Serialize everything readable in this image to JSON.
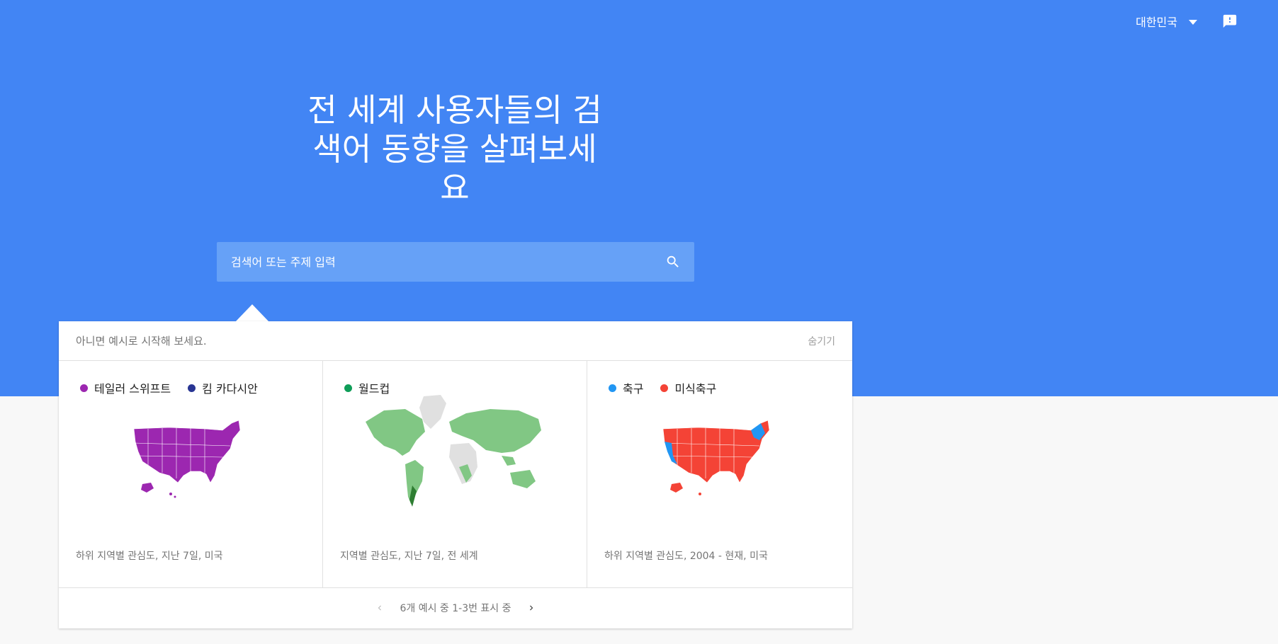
{
  "header": {
    "region": "대한민국",
    "headline": "전 세계 사용자들의 검색어 동향을 살펴보세요"
  },
  "search": {
    "placeholder": "검색어 또는 주제 입력"
  },
  "examples_panel": {
    "intro": "아니면 예시로 시작해 보세요.",
    "hide_label": "숨기기",
    "items": [
      {
        "terms": [
          {
            "label": "테일러 스위프트",
            "color": "#9c27b0"
          },
          {
            "label": "킴 카다시안",
            "color": "#283593"
          }
        ],
        "caption": "하위 지역별 관심도, 지난 7일, 미국"
      },
      {
        "terms": [
          {
            "label": "월드컵",
            "color": "#0f9d58"
          }
        ],
        "caption": "지역별 관심도, 지난 7일, 전 세계"
      },
      {
        "terms": [
          {
            "label": "축구",
            "color": "#2196f3"
          },
          {
            "label": "미식축구",
            "color": "#f44336"
          }
        ],
        "caption": "하위 지역별 관심도, 2004 - 현재, 미국"
      }
    ],
    "pagination": "6개 예시 중 1-3번 표시 중"
  },
  "icons": {
    "region_caret": "caret-down-icon",
    "feedback": "feedback-icon",
    "search": "search-icon",
    "prev": "chevron-left-icon",
    "next": "chevron-right-icon"
  },
  "colors": {
    "hero": "#4285f4",
    "search_bg": "#66a1f7",
    "us_purple": "#9c27b0",
    "world_green": "#81c784",
    "us_red": "#f44336",
    "us_blue": "#2196f3"
  }
}
